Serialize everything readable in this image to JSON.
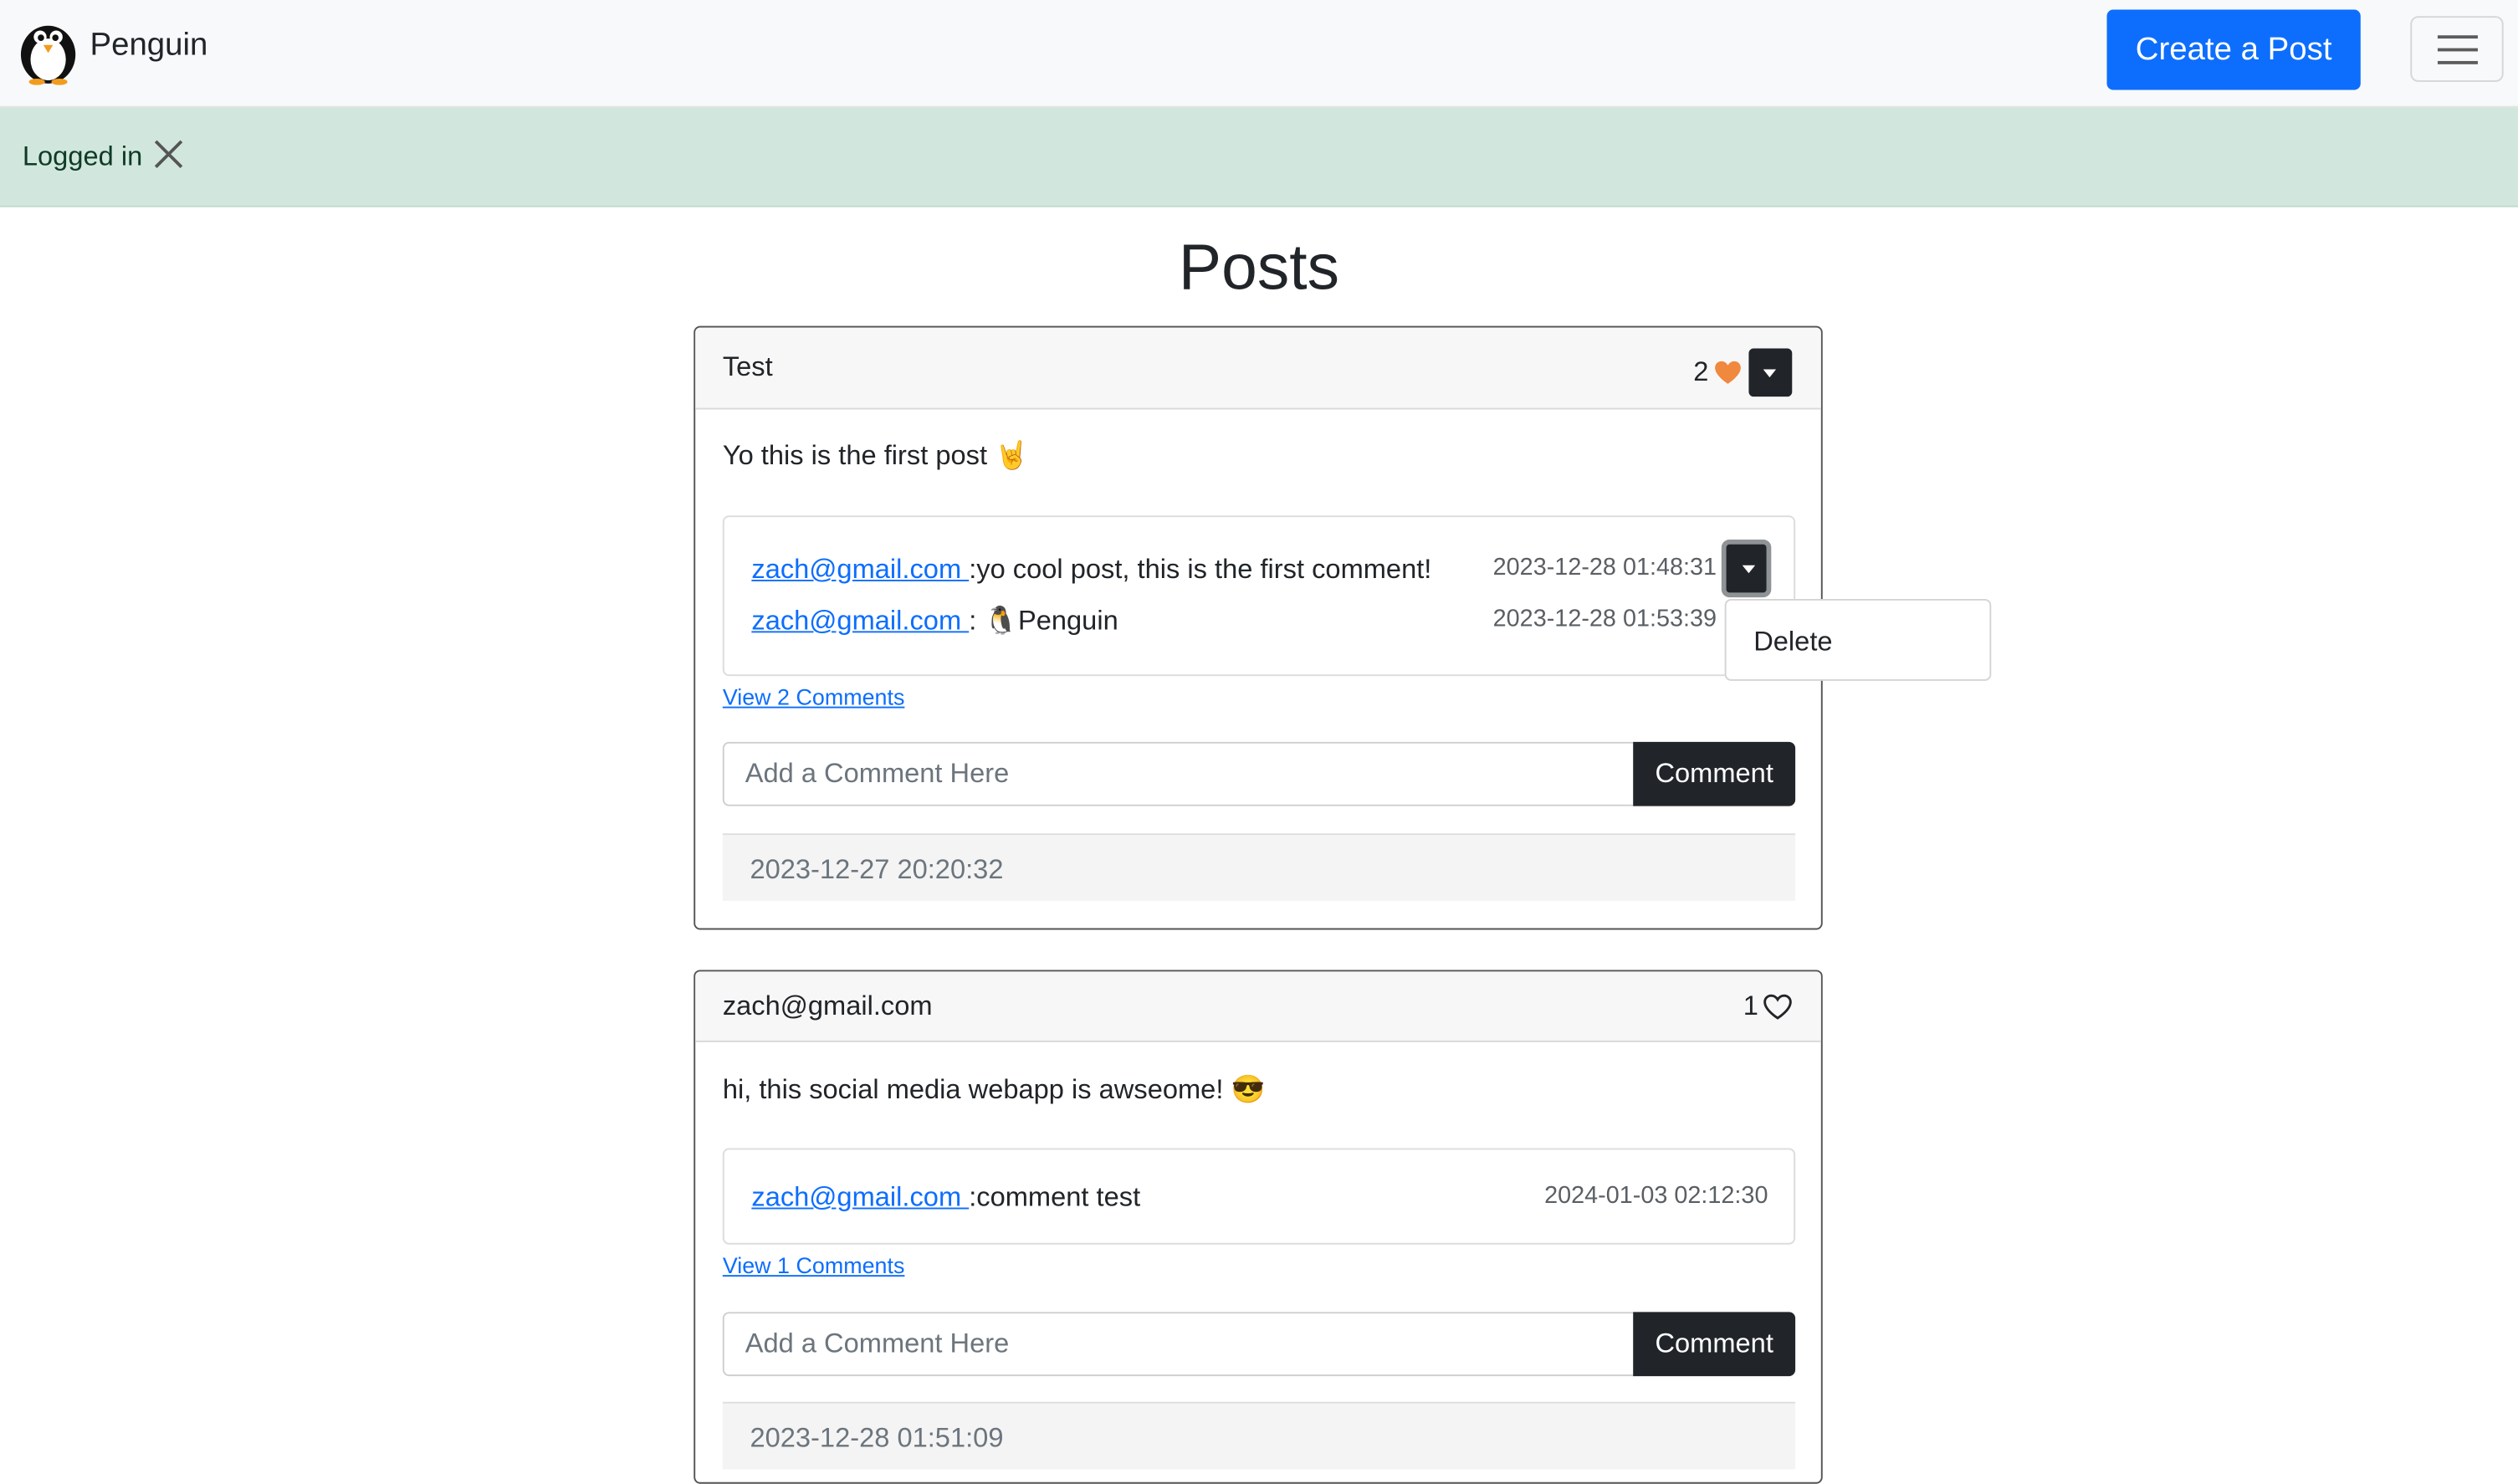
{
  "navbar": {
    "brand": "Penguin",
    "create_button": "Create a Post",
    "menu_icon": "hamburger-icon"
  },
  "alert": {
    "message": "Logged in",
    "close_icon": "close-icon"
  },
  "page": {
    "title": "Posts"
  },
  "posts": [
    {
      "title": "Test",
      "likes": "2",
      "liked": true,
      "heart_color": "#f0883e",
      "body": "Yo this is the first post 🤘",
      "comments": [
        {
          "author": "zach@gmail.com ",
          "text": ":yo cool post, this is the first comment!",
          "timestamp": "2023-12-28 01:48:31"
        },
        {
          "author": "zach@gmail.com ",
          "text": ": 🐧Penguin",
          "timestamp": "2023-12-28 01:53:39"
        }
      ],
      "view_link": "View 2 Comments",
      "input_placeholder": "Add a Comment Here",
      "comment_button": "Comment",
      "created": "2023-12-27 20:20:32"
    },
    {
      "title": "zach@gmail.com",
      "likes": "1",
      "liked": false,
      "body": "hi, this social media webapp is awseome! 😎",
      "comments": [
        {
          "author": "zach@gmail.com ",
          "text": ":comment test",
          "timestamp": "2024-01-03 02:12:30"
        }
      ],
      "view_link": "View 1 Comments",
      "input_placeholder": "Add a Comment Here",
      "comment_button": "Comment",
      "created": "2023-12-28 01:51:09"
    }
  ],
  "dropdown_menu": {
    "items": [
      "Delete"
    ]
  },
  "colors": {
    "primary": "#0d6efd",
    "dark": "#212529",
    "alert_bg": "#d1e7dd"
  }
}
